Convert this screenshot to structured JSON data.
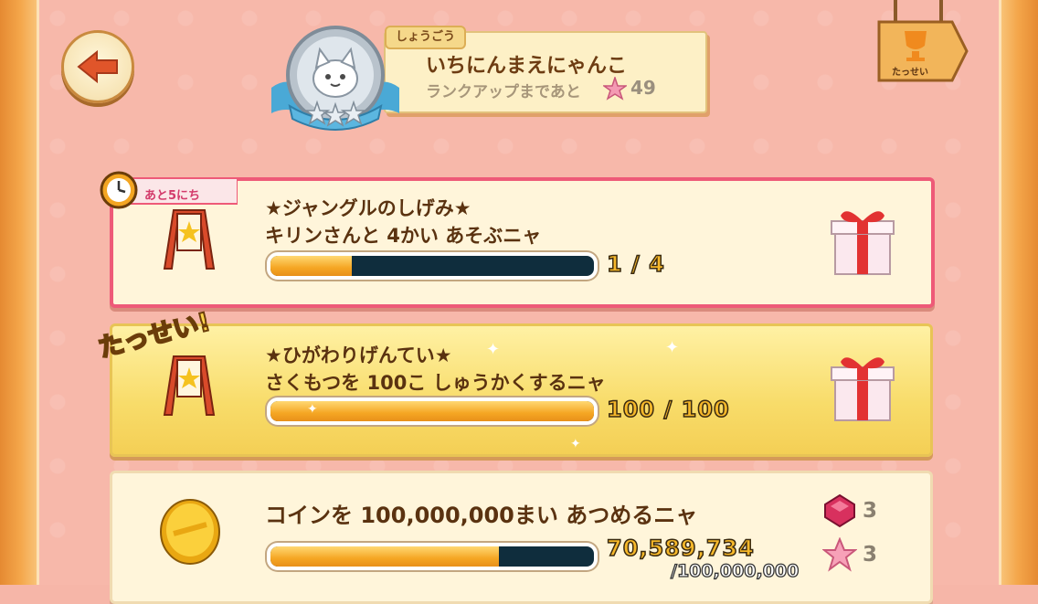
{
  "header": {
    "title_tab": "しょうごう",
    "title": "いちにんまえにゃんこ",
    "rank_up_label": "ランクアップまであと",
    "rank_up_remaining": "49",
    "achievements_label": "たっせい"
  },
  "missions": [
    {
      "deadline": "あと5にち",
      "title_line1": "★ジャングルのしげみ★",
      "title_line2": "キリンさんと 4かい あそぶニャ",
      "progress": 0.25,
      "count": "1 / 4"
    },
    {
      "badge": "たっせい!",
      "title_line1": "★ひがわりげんてい★",
      "title_line2": "さくもつを 100こ しゅうかくするニャ",
      "progress": 1.0,
      "count": "100 / 100"
    },
    {
      "title_line1": "コインを 100,000,000まい あつめるニャ",
      "progress": 0.7059,
      "current": "70,589,734",
      "target": "/100,000,000",
      "rewards": [
        {
          "icon": "gem-icon",
          "amount": "3"
        },
        {
          "icon": "star-icon",
          "amount": "3"
        }
      ]
    }
  ],
  "colors": {
    "accent_pink": "#ee5a78",
    "progress_fill": "#f5a623",
    "bar_track": "#0f2d3d"
  }
}
